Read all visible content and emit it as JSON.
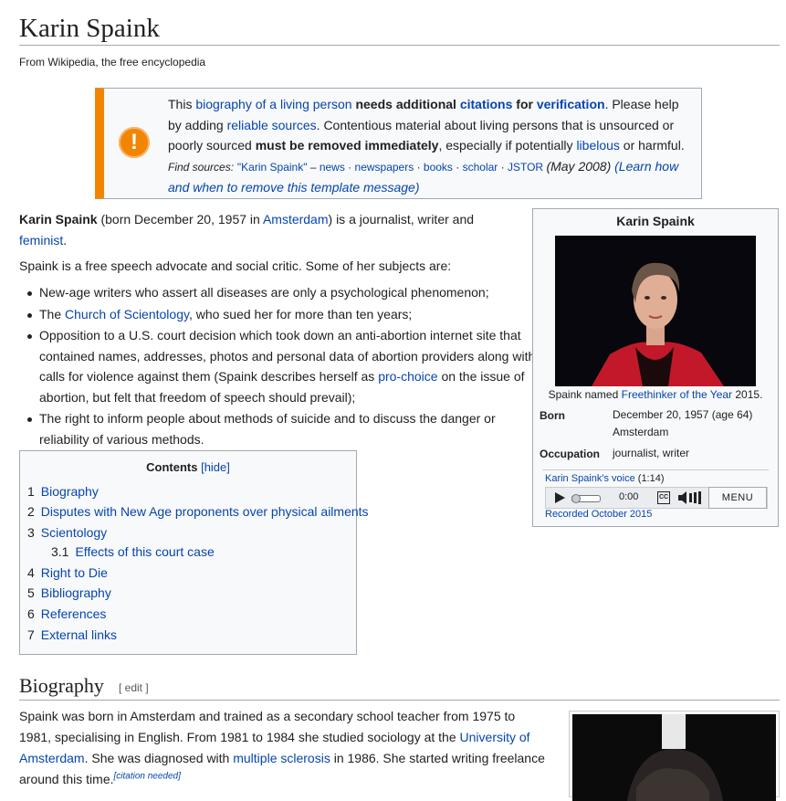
{
  "page_title": "Karin Spaink",
  "tagline": "From Wikipedia, the free encyclopedia",
  "ambox": {
    "icon": "exclamation-icon",
    "t1": "This ",
    "l1": "biography of a living person",
    "t2": " ",
    "b1": "needs additional",
    "t3": " ",
    "l2": "citations",
    "t4": " ",
    "b2": "for",
    "t5": " ",
    "l3": "verification",
    "t6": ". Please help by adding ",
    "l4": "reliable sources",
    "t7": ". Contentious material about living persons that is unsourced or poorly sourced ",
    "b3": "must be removed immediately",
    "t8": ", especially if potentially ",
    "l5": "libelous",
    "t9": " or harmful.",
    "fs_label": "Find sources:",
    "fs_links": [
      "\"Karin Spaink\"",
      "news",
      "newspapers",
      "books",
      "scholar",
      "JSTOR"
    ],
    "date": "(May 2008)",
    "learn": "(Learn how and when to remove this template message)"
  },
  "lead": {
    "name": "Karin Spaink",
    "t1": " (born December 20, 1957 in ",
    "l1": "Amsterdam",
    "t2": ") is a journalist, writer and ",
    "l2": "feminist",
    "t3": ".",
    "p2": "Spaink is a free speech advocate and social critic. Some of her subjects are:"
  },
  "subjects": {
    "i1": "New-age writers who assert all diseases are only a psychological phenomenon;",
    "i2a": "The ",
    "i2l": "Church of Scientology",
    "i2b": ", who sued her for more than ten years;",
    "i3a": "Opposition to a U.S. court decision which took down an anti-abortion internet site that contained names, addresses, photos and personal data of abortion providers along with calls for violence against them (Spaink describes herself as ",
    "i3l": "pro-choice",
    "i3b": " on the issue of abortion, but felt that freedom of speech should prevail);",
    "i4": "The right to inform people about methods of suicide and to discuss the danger or reliability of various methods."
  },
  "infobox": {
    "title": "Karin Spaink",
    "caption_a": "Spaink named ",
    "caption_l": "Freethinker of the Year",
    "caption_b": " 2015.",
    "born_label": "Born",
    "born_date": "December 20, 1957 (age 64)",
    "born_place": "Amsterdam",
    "occupation_label": "Occupation",
    "occupation": "journalist, writer",
    "audio_link": "Karin Spaink's voice",
    "audio_len": " (1:14)",
    "time": "0:00",
    "cc": "CC",
    "menu": "MENU",
    "recorded": "Recorded October 2015"
  },
  "toc": {
    "title": "Contents",
    "hide": "[hide]",
    "items": [
      {
        "num": "1",
        "label": "Biography"
      },
      {
        "num": "2",
        "label": "Disputes with New Age proponents over physical ailments"
      },
      {
        "num": "3",
        "label": "Scientology"
      },
      {
        "num": "3.1",
        "label": "Effects of this court case"
      },
      {
        "num": "4",
        "label": "Right to Die"
      },
      {
        "num": "5",
        "label": "Bibliography"
      },
      {
        "num": "6",
        "label": "References"
      },
      {
        "num": "7",
        "label": "External links"
      }
    ]
  },
  "biography": {
    "heading": "Biography",
    "edit": "[ edit ]",
    "t1": "Spaink was born in Amsterdam and trained as a secondary school teacher from 1975 to 1981, specialising in English. From 1981 to 1984 she studied sociology at the ",
    "l1": "University of Amsterdam",
    "t2": ". She was diagnosed with ",
    "l2": "multiple sclerosis",
    "t3": " in 1986. She started writing freelance around this time.",
    "cn": "[citation needed]"
  }
}
